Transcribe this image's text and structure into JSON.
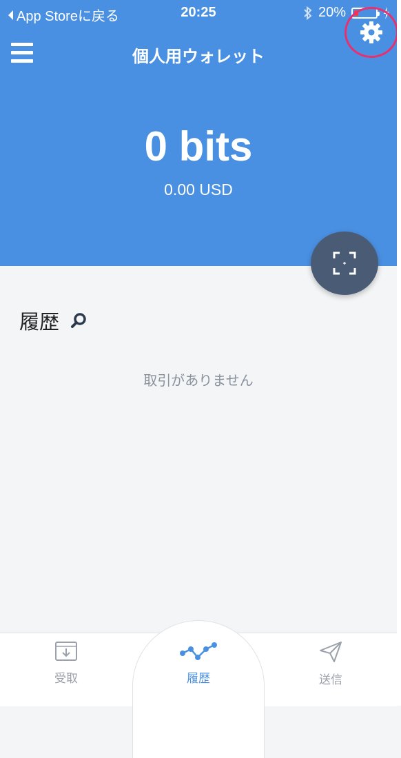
{
  "status_bar": {
    "back_label": "App Storeに戻る",
    "time": "20:25",
    "battery_percent": "20%",
    "battery_level": 0.2
  },
  "nav": {
    "title": "個人用ウォレット",
    "menu_icon": "hamburger-menu-icon",
    "settings_icon": "gear-icon"
  },
  "balance": {
    "main": "0 bits",
    "fiat": "0.00 USD"
  },
  "history": {
    "title": "履歴",
    "empty_message": "取引がありません"
  },
  "tabs": [
    {
      "label": "受取",
      "icon": "receive-inbox-icon",
      "active": false
    },
    {
      "label": "履歴",
      "icon": "history-chart-icon",
      "active": true
    },
    {
      "label": "送信",
      "icon": "send-paper-plane-icon",
      "active": false
    }
  ],
  "colors": {
    "header": "#4a90e2",
    "scan_button": "#4a5c75",
    "highlight_ring": "#e8306f",
    "active_tab": "#4a90e2",
    "inactive_tab": "#9aa1aa"
  }
}
